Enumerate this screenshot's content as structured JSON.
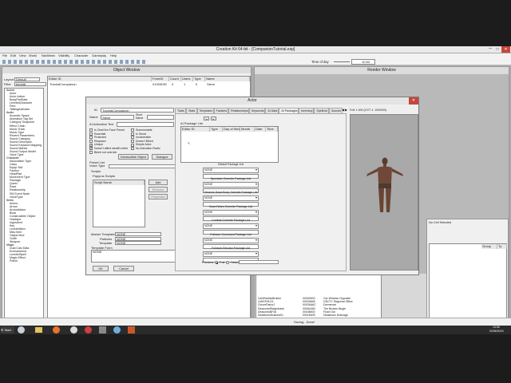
{
  "app": {
    "title": "Creation Kit 64-bit - [CompanionTutorial.esp]",
    "menu": [
      "File",
      "Edit",
      "View",
      "World",
      "NavMesh",
      "Visibility",
      "Character",
      "Gameplay",
      "Help"
    ],
    "time_label": "Time of day",
    "time_value": "10.83"
  },
  "object_window": {
    "title": "Object Window",
    "filter_dropdown": "Default",
    "filter_label": "Filter",
    "filter_value": "tutorial",
    "columns": [
      "Editor ID",
      "FormID",
      "Count",
      "Users",
      "Type",
      "Name"
    ],
    "row": {
      "editor_id": "TutorialCompanion",
      "form_id": "01000D90",
      "count": "0",
      "users": "1",
      "type": "0",
      "name": "Steve"
    },
    "tree": [
      {
        "label": "Actors",
        "cat": true
      },
      {
        "label": "Actor"
      },
      {
        "label": "Actor Action"
      },
      {
        "label": "BodyPartData"
      },
      {
        "label": "LeveledCharacter"
      },
      {
        "label": "Perk"
      },
      {
        "label": "TalkingActivator"
      },
      {
        "label": "Audio",
        "cat": true
      },
      {
        "label": "Acoustic Space"
      },
      {
        "label": "Animation Tag Set"
      },
      {
        "label": "Category Snapshot"
      },
      {
        "label": "Effect Chain"
      },
      {
        "label": "Music Track"
      },
      {
        "label": "Music Type"
      },
      {
        "label": "Reverb Parameters"
      },
      {
        "label": "Sound Category"
      },
      {
        "label": "Sound Descriptor"
      },
      {
        "label": "Sound Keyword Mapping"
      },
      {
        "label": "Sound Marker"
      },
      {
        "label": "Sound Output Model"
      },
      {
        "label": "Voice Type"
      },
      {
        "label": "Character",
        "cat": true
      },
      {
        "label": "Association Type"
      },
      {
        "label": "Class"
      },
      {
        "label": "Equip Slot"
      },
      {
        "label": "Faction"
      },
      {
        "label": "HeadPart"
      },
      {
        "label": "Movement Type"
      },
      {
        "label": "Package"
      },
      {
        "label": "Quest"
      },
      {
        "label": "Race"
      },
      {
        "label": "Relationship"
      },
      {
        "label": "SM Event Node"
      },
      {
        "label": "VoiceType"
      },
      {
        "label": "Items",
        "cat": true
      },
      {
        "label": "Ammo"
      },
      {
        "label": "Armor"
      },
      {
        "label": "ArmorAddon"
      },
      {
        "label": "Book"
      },
      {
        "label": "Constructible Object"
      },
      {
        "label": "Holotape"
      },
      {
        "label": "Ingredient"
      },
      {
        "label": "Key"
      },
      {
        "label": "LeveledItem"
      },
      {
        "label": "Misc Item"
      },
      {
        "label": "Object Mod"
      },
      {
        "label": "Outfit"
      },
      {
        "label": "Weapon"
      },
      {
        "label": "Magic",
        "cat": true
      },
      {
        "label": "Dual Cast Data"
      },
      {
        "label": "Enchantment"
      },
      {
        "label": "LeveledSpell"
      },
      {
        "label": "Magic Effect"
      },
      {
        "label": "Potion"
      }
    ]
  },
  "actor_dialog": {
    "title": "Actor",
    "id_label": "ID",
    "id_value": "TutorialCompanion",
    "name_label": "Name",
    "name_value": "Steve",
    "short_name_label": "Short Name",
    "ai_activation_label": "AI Activation Text",
    "checkboxes_left": [
      {
        "label": "Is CharGen Face Preset",
        "checked": false
      },
      {
        "label": "Essential",
        "checked": false
      },
      {
        "label": "Protected",
        "checked": false
      },
      {
        "label": "Respawn",
        "checked": false
      },
      {
        "label": "Unique",
        "checked": true
      },
      {
        "label": "Doesn't affect stealth meter",
        "checked": true
      },
      {
        "label": "Bleed out override",
        "checked": false
      }
    ],
    "checkboxes_right": [
      {
        "label": "Summonable",
        "checked": false
      },
      {
        "label": "Is Ghost",
        "checked": false
      },
      {
        "label": "Invulnerable",
        "checked": false
      },
      {
        "label": "Doesn't Bleed",
        "checked": false
      },
      {
        "label": "Simple Actor",
        "checked": false
      },
      {
        "label": "No Activation Radio",
        "checked": false
      }
    ],
    "destructible_button": "Destructible Object",
    "dialogue_button": "Dialogue",
    "preset_list_label": "Preset List",
    "voice_type_label": "Voice Type",
    "scripts_label": "Scripts",
    "papyrus_label": "Papyrus Scripts",
    "script_col": "Script Name",
    "add_button": "Add",
    "remove_button": "Remove",
    "properties_button": "Properties",
    "marker_label": "Marker Template",
    "marker_value": "NONE",
    "fields": [
      {
        "label": "Particles",
        "value": "NONE"
      },
      {
        "label": "Template",
        "value": "NONE"
      }
    ],
    "template_form_label": "Template Form",
    "template_form_value": "NONE",
    "ok_button": "OK",
    "cancel_button": "Cancel",
    "tabs": [
      "Traits",
      "Stats",
      "Templates",
      "Factions",
      "Relationships",
      "Keywords",
      "AI Data",
      "AI Packages",
      "Inventory",
      "SpellList",
      "Sounds"
    ],
    "active_tab": "AI Packages",
    "stat_line": "Fcft: 1.000 (1077.1: 1000000)",
    "ai_package_list_label": "AI Package List",
    "package_cols": [
      "Editor ID",
      "Type",
      "Day of Week",
      "Month",
      "Date",
      "Time"
    ],
    "package_groups": [
      {
        "label": "Default Package List",
        "value": "NONE"
      },
      {
        "label": "Spectator Override Package List",
        "value": "NONE"
      },
      {
        "label": "Observe Dead Body Override Package List",
        "value": "NONE"
      },
      {
        "label": "Guard Warn Override Package List",
        "value": "NONE"
      },
      {
        "label": "Combat Override Package List",
        "value": "NONE"
      },
      {
        "label": "Follower Command Package List",
        "value": "NONE"
      },
      {
        "label": "Follower Elevator Package List",
        "value": "NONE"
      }
    ],
    "preview_label": "Preview",
    "full_label": "Full",
    "head_label": "Head"
  },
  "render_window": {
    "title": "Render Window",
    "no_cell": "No Cell Selected",
    "cols": [
      "Group",
      "Ty"
    ]
  },
  "cell_list": {
    "rows": [
      {
        "id": "CarWindowBroken",
        "form": "00000000",
        "name": "Car Window Opposite"
      },
      {
        "id": "CellGFHLD1",
        "form": "00026648",
        "name": "GDCT1 Regional Office"
      },
      {
        "id": "CloverParlor2",
        "form": "00026A6C",
        "name": "Dormmont"
      },
      {
        "id": "DeacontoRidgedrank",
        "form": "000A0462",
        "name": "The Broken Bugle"
      },
      {
        "id": "DeacontoBFull",
        "form": "00048000",
        "name": "Flush Out"
      },
      {
        "id": "DeadtownDrained01",
        "form": "00018005",
        "name": "Deadtown Drainage"
      }
    ]
  },
  "status": {
    "text": "Saving...Done!"
  },
  "taskbar": {
    "start": "Start",
    "time": "14:06",
    "date": "02/06/2016"
  }
}
